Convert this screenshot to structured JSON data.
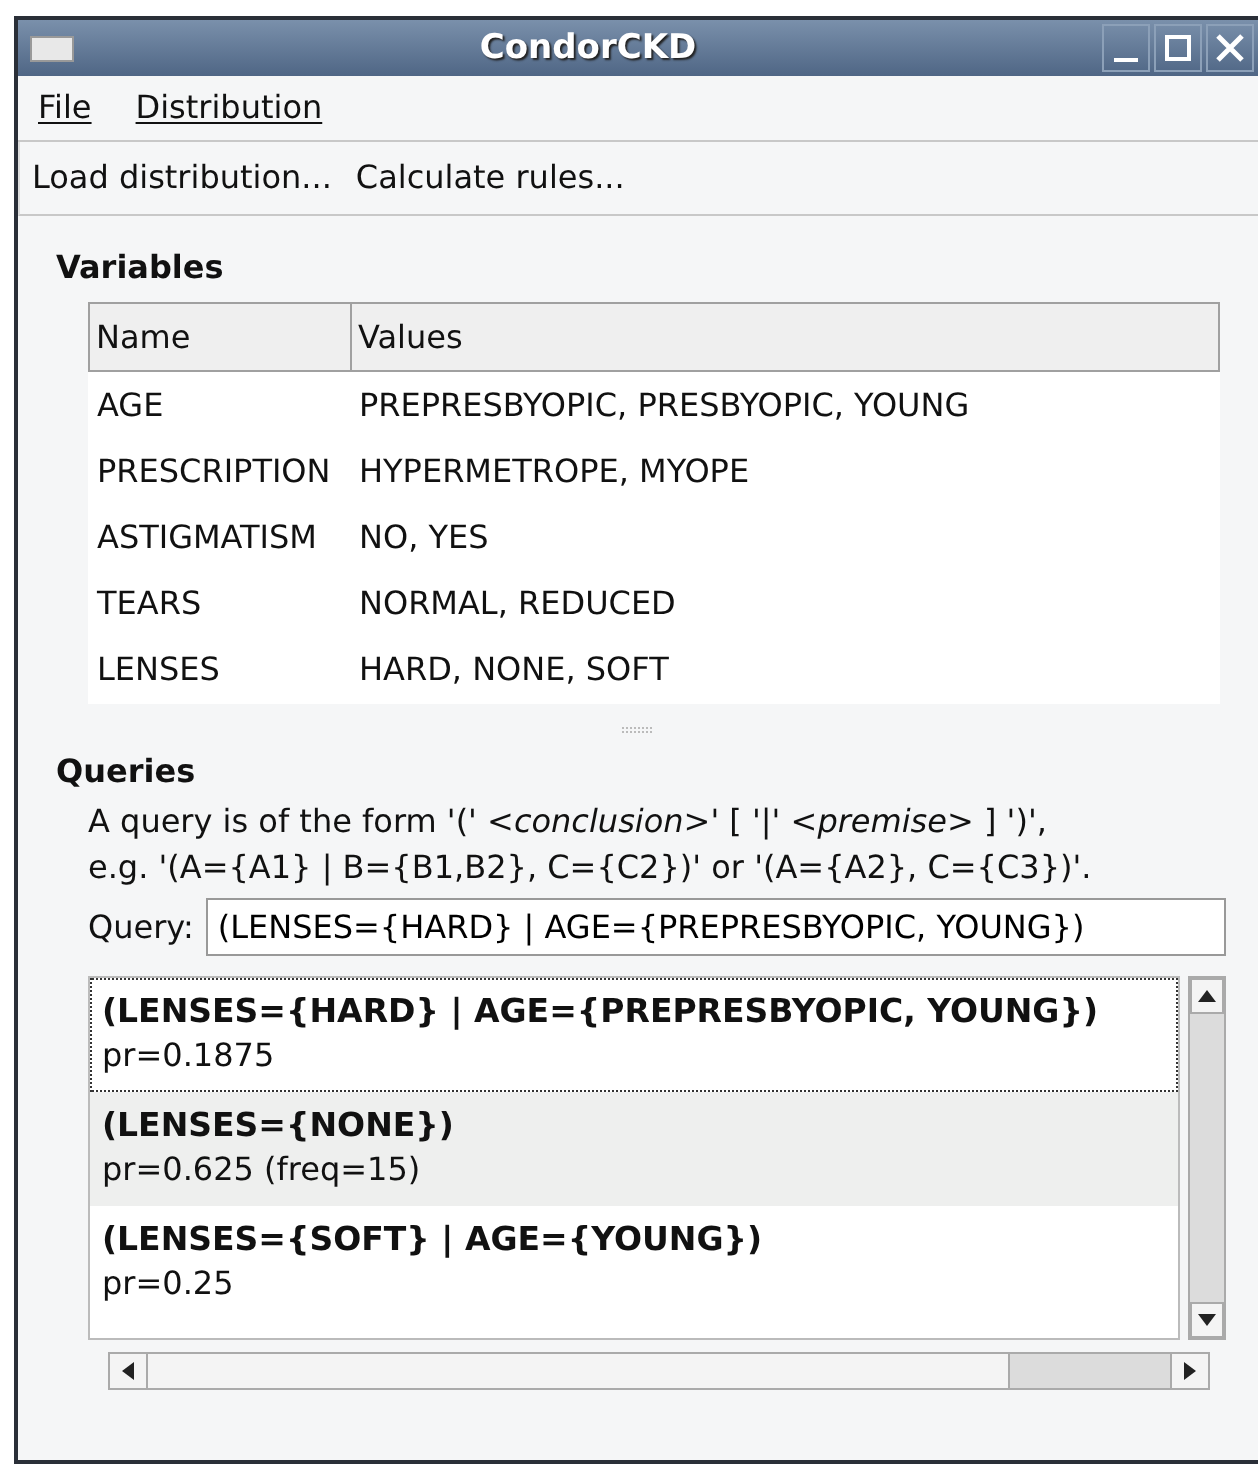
{
  "window": {
    "title": "CondorCKD"
  },
  "menu": [
    "File",
    "Distribution"
  ],
  "toolbar": [
    "Load distribution...",
    "Calculate rules..."
  ],
  "variables": {
    "heading": "Variables",
    "columns": [
      "Name",
      "Values"
    ],
    "rows": [
      [
        "AGE",
        "PREPRESBYOPIC, PRESBYOPIC, YOUNG"
      ],
      [
        "PRESCRIPTION",
        "HYPERMETROPE, MYOPE"
      ],
      [
        "ASTIGMATISM",
        "NO, YES"
      ],
      [
        "TEARS",
        "NORMAL, REDUCED"
      ],
      [
        "LENSES",
        "HARD, NONE, SOFT"
      ]
    ]
  },
  "queries": {
    "heading": "Queries",
    "description": [
      "A query is of the form '(' *<conclusion>*' [ '|' *<premise>* ] ')',",
      "e.g. '(A={A1} | B={B1,B2}, C={C2})' or '(A={A2}, C={C3})'."
    ],
    "query_label": "Query:",
    "query_value": "(LENSES={HARD} | AGE={PREPRESBYOPIC, YOUNG})",
    "results": [
      {
        "rule": "(LENSES={HARD} | AGE={PREPRESBYOPIC, YOUNG})",
        "detail": "pr=0.1875",
        "focused": true
      },
      {
        "rule": "(LENSES={NONE})",
        "detail": "pr=0.625 (freq=15)",
        "focused": false
      },
      {
        "rule": "(LENSES={SOFT} | AGE={YOUNG})",
        "detail": "pr=0.25",
        "focused": false
      }
    ]
  }
}
